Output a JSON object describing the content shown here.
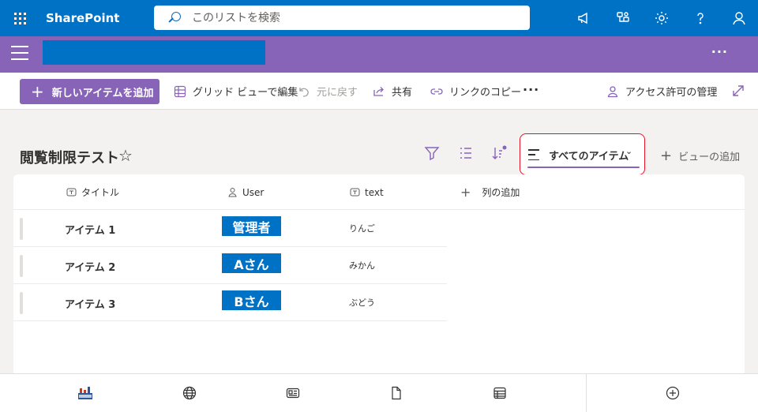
{
  "suite": {
    "brand": "SharePoint",
    "search_placeholder": "このリストを検索",
    "colors": {
      "suite_bar": "#0072c6",
      "accent": "#8764b8"
    }
  },
  "site_header": {
    "more_label": "···"
  },
  "command_bar": {
    "new_item": "新しいアイテムを追加",
    "grid_edit": "グリッド ビューで編集",
    "undo": "元に戻す",
    "share": "共有",
    "copy_link": "リンクのコピー",
    "more": "···",
    "manage_access": "アクセス許可の管理"
  },
  "list": {
    "title": "閲覧制限テスト",
    "current_view": "すべてのアイテム",
    "add_view": "ビューの追加",
    "columns": [
      {
        "label": "タイトル",
        "icon": "text-field-icon"
      },
      {
        "label": "User",
        "icon": "person-icon"
      },
      {
        "label": "text",
        "icon": "text-field-icon"
      }
    ],
    "add_column": "列の追加",
    "rows": [
      {
        "title": "アイテム 1",
        "user": "管理者",
        "text": "りんご"
      },
      {
        "title": "アイテム 2",
        "user": "Aさん",
        "text": "みかん"
      },
      {
        "title": "アイテム 3",
        "user": "Bさん",
        "text": "ぶどう"
      }
    ]
  },
  "bottom_bar": {
    "icons": [
      "site-logo-icon",
      "globe-icon",
      "news-icon",
      "document-icon",
      "list-icon",
      "add-circle-icon"
    ]
  }
}
